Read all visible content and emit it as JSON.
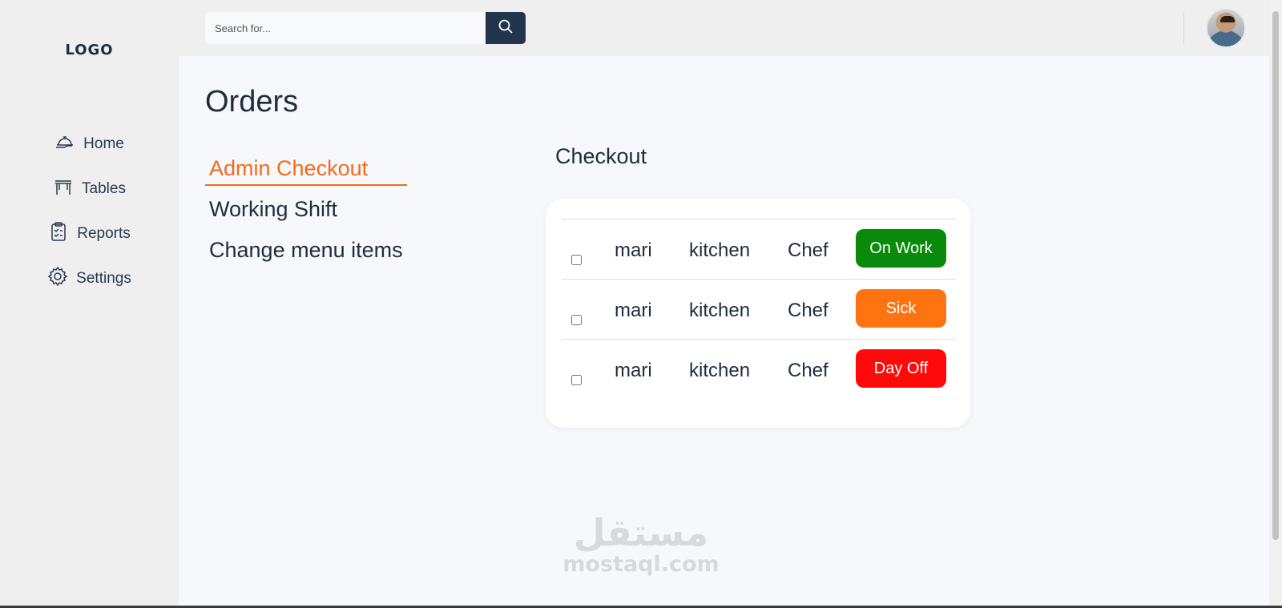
{
  "sidebar": {
    "logo": "LOGO",
    "items": [
      {
        "label": "Home",
        "icon": "cloche-icon"
      },
      {
        "label": "Tables",
        "icon": "table-icon"
      },
      {
        "label": "Reports",
        "icon": "clipboard-report-icon"
      },
      {
        "label": "Settings",
        "icon": "gear-icon"
      }
    ]
  },
  "header": {
    "search_placeholder": "Search for...",
    "search_icon": "search-icon"
  },
  "main": {
    "title": "Orders",
    "subnav": [
      {
        "label": "Admin Checkout",
        "active": true
      },
      {
        "label": "Working Shift",
        "active": false
      },
      {
        "label": "Change menu items",
        "active": false
      }
    ],
    "section_title": "Checkout",
    "rows": [
      {
        "name": "mari",
        "department": "kitchen",
        "role": "Chef",
        "status": "On Work",
        "status_color": "#0a8a0a"
      },
      {
        "name": "mari",
        "department": "kitchen",
        "role": "Chef",
        "status": "Sick",
        "status_color": "#ff7410"
      },
      {
        "name": "mari",
        "department": "kitchen",
        "role": "Chef",
        "status": "Day Off",
        "status_color": "#ff0a0a"
      }
    ]
  },
  "watermark": {
    "arabic": "مستقل",
    "latin": "mostaql.com"
  },
  "colors": {
    "accent": "#f26b1d",
    "sidebar_bg": "#efefef",
    "main_bg": "#f7f8fc",
    "search_button": "#22354d"
  }
}
